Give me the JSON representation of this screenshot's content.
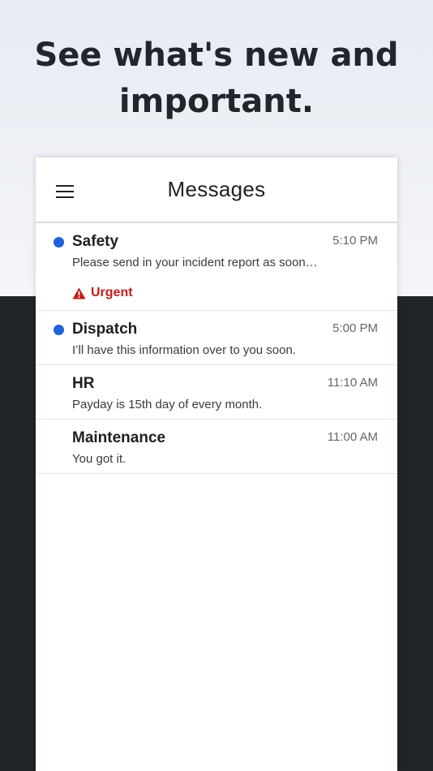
{
  "headline": {
    "line1": "See what's new and",
    "line2": "important."
  },
  "app": {
    "title": "Messages",
    "menu_icon": "hamburger-menu-icon"
  },
  "messages": [
    {
      "sender": "Safety",
      "time": "5:10 PM",
      "preview": "Please send in your incident report as soon…",
      "unread": true,
      "badge": "Urgent",
      "badge_icon": "warning-icon",
      "badge_color": "#c41c1c"
    },
    {
      "sender": "Dispatch",
      "time": "5:00 PM",
      "preview": "I’ll have this information over to you soon.",
      "unread": true
    },
    {
      "sender": "HR",
      "time": "11:10 AM",
      "preview": "Payday is 15th day of every month.",
      "unread": false
    },
    {
      "sender": "Maintenance",
      "time": "11:00 AM",
      "preview": "You got it.",
      "unread": false
    }
  ],
  "colors": {
    "unread_dot": "#1f63d6",
    "dark_background": "#212427"
  }
}
